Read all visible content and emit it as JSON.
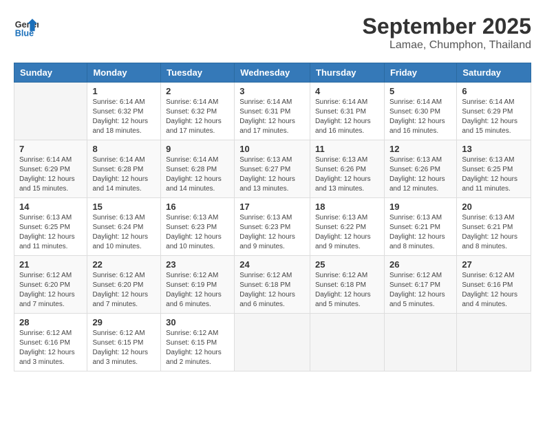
{
  "header": {
    "logo_line1": "General",
    "logo_line2": "Blue",
    "title": "September 2025",
    "subtitle": "Lamae, Chumphon, Thailand"
  },
  "days_of_week": [
    "Sunday",
    "Monday",
    "Tuesday",
    "Wednesday",
    "Thursday",
    "Friday",
    "Saturday"
  ],
  "weeks": [
    [
      {
        "day": "",
        "sunrise": "",
        "sunset": "",
        "daylight": ""
      },
      {
        "day": "1",
        "sunrise": "Sunrise: 6:14 AM",
        "sunset": "Sunset: 6:32 PM",
        "daylight": "Daylight: 12 hours and 18 minutes."
      },
      {
        "day": "2",
        "sunrise": "Sunrise: 6:14 AM",
        "sunset": "Sunset: 6:32 PM",
        "daylight": "Daylight: 12 hours and 17 minutes."
      },
      {
        "day": "3",
        "sunrise": "Sunrise: 6:14 AM",
        "sunset": "Sunset: 6:31 PM",
        "daylight": "Daylight: 12 hours and 17 minutes."
      },
      {
        "day": "4",
        "sunrise": "Sunrise: 6:14 AM",
        "sunset": "Sunset: 6:31 PM",
        "daylight": "Daylight: 12 hours and 16 minutes."
      },
      {
        "day": "5",
        "sunrise": "Sunrise: 6:14 AM",
        "sunset": "Sunset: 6:30 PM",
        "daylight": "Daylight: 12 hours and 16 minutes."
      },
      {
        "day": "6",
        "sunrise": "Sunrise: 6:14 AM",
        "sunset": "Sunset: 6:29 PM",
        "daylight": "Daylight: 12 hours and 15 minutes."
      }
    ],
    [
      {
        "day": "7",
        "sunrise": "Sunrise: 6:14 AM",
        "sunset": "Sunset: 6:29 PM",
        "daylight": "Daylight: 12 hours and 15 minutes."
      },
      {
        "day": "8",
        "sunrise": "Sunrise: 6:14 AM",
        "sunset": "Sunset: 6:28 PM",
        "daylight": "Daylight: 12 hours and 14 minutes."
      },
      {
        "day": "9",
        "sunrise": "Sunrise: 6:14 AM",
        "sunset": "Sunset: 6:28 PM",
        "daylight": "Daylight: 12 hours and 14 minutes."
      },
      {
        "day": "10",
        "sunrise": "Sunrise: 6:13 AM",
        "sunset": "Sunset: 6:27 PM",
        "daylight": "Daylight: 12 hours and 13 minutes."
      },
      {
        "day": "11",
        "sunrise": "Sunrise: 6:13 AM",
        "sunset": "Sunset: 6:26 PM",
        "daylight": "Daylight: 12 hours and 13 minutes."
      },
      {
        "day": "12",
        "sunrise": "Sunrise: 6:13 AM",
        "sunset": "Sunset: 6:26 PM",
        "daylight": "Daylight: 12 hours and 12 minutes."
      },
      {
        "day": "13",
        "sunrise": "Sunrise: 6:13 AM",
        "sunset": "Sunset: 6:25 PM",
        "daylight": "Daylight: 12 hours and 11 minutes."
      }
    ],
    [
      {
        "day": "14",
        "sunrise": "Sunrise: 6:13 AM",
        "sunset": "Sunset: 6:25 PM",
        "daylight": "Daylight: 12 hours and 11 minutes."
      },
      {
        "day": "15",
        "sunrise": "Sunrise: 6:13 AM",
        "sunset": "Sunset: 6:24 PM",
        "daylight": "Daylight: 12 hours and 10 minutes."
      },
      {
        "day": "16",
        "sunrise": "Sunrise: 6:13 AM",
        "sunset": "Sunset: 6:23 PM",
        "daylight": "Daylight: 12 hours and 10 minutes."
      },
      {
        "day": "17",
        "sunrise": "Sunrise: 6:13 AM",
        "sunset": "Sunset: 6:23 PM",
        "daylight": "Daylight: 12 hours and 9 minutes."
      },
      {
        "day": "18",
        "sunrise": "Sunrise: 6:13 AM",
        "sunset": "Sunset: 6:22 PM",
        "daylight": "Daylight: 12 hours and 9 minutes."
      },
      {
        "day": "19",
        "sunrise": "Sunrise: 6:13 AM",
        "sunset": "Sunset: 6:21 PM",
        "daylight": "Daylight: 12 hours and 8 minutes."
      },
      {
        "day": "20",
        "sunrise": "Sunrise: 6:13 AM",
        "sunset": "Sunset: 6:21 PM",
        "daylight": "Daylight: 12 hours and 8 minutes."
      }
    ],
    [
      {
        "day": "21",
        "sunrise": "Sunrise: 6:12 AM",
        "sunset": "Sunset: 6:20 PM",
        "daylight": "Daylight: 12 hours and 7 minutes."
      },
      {
        "day": "22",
        "sunrise": "Sunrise: 6:12 AM",
        "sunset": "Sunset: 6:20 PM",
        "daylight": "Daylight: 12 hours and 7 minutes."
      },
      {
        "day": "23",
        "sunrise": "Sunrise: 6:12 AM",
        "sunset": "Sunset: 6:19 PM",
        "daylight": "Daylight: 12 hours and 6 minutes."
      },
      {
        "day": "24",
        "sunrise": "Sunrise: 6:12 AM",
        "sunset": "Sunset: 6:18 PM",
        "daylight": "Daylight: 12 hours and 6 minutes."
      },
      {
        "day": "25",
        "sunrise": "Sunrise: 6:12 AM",
        "sunset": "Sunset: 6:18 PM",
        "daylight": "Daylight: 12 hours and 5 minutes."
      },
      {
        "day": "26",
        "sunrise": "Sunrise: 6:12 AM",
        "sunset": "Sunset: 6:17 PM",
        "daylight": "Daylight: 12 hours and 5 minutes."
      },
      {
        "day": "27",
        "sunrise": "Sunrise: 6:12 AM",
        "sunset": "Sunset: 6:16 PM",
        "daylight": "Daylight: 12 hours and 4 minutes."
      }
    ],
    [
      {
        "day": "28",
        "sunrise": "Sunrise: 6:12 AM",
        "sunset": "Sunset: 6:16 PM",
        "daylight": "Daylight: 12 hours and 3 minutes."
      },
      {
        "day": "29",
        "sunrise": "Sunrise: 6:12 AM",
        "sunset": "Sunset: 6:15 PM",
        "daylight": "Daylight: 12 hours and 3 minutes."
      },
      {
        "day": "30",
        "sunrise": "Sunrise: 6:12 AM",
        "sunset": "Sunset: 6:15 PM",
        "daylight": "Daylight: 12 hours and 2 minutes."
      },
      {
        "day": "",
        "sunrise": "",
        "sunset": "",
        "daylight": ""
      },
      {
        "day": "",
        "sunrise": "",
        "sunset": "",
        "daylight": ""
      },
      {
        "day": "",
        "sunrise": "",
        "sunset": "",
        "daylight": ""
      },
      {
        "day": "",
        "sunrise": "",
        "sunset": "",
        "daylight": ""
      }
    ]
  ]
}
